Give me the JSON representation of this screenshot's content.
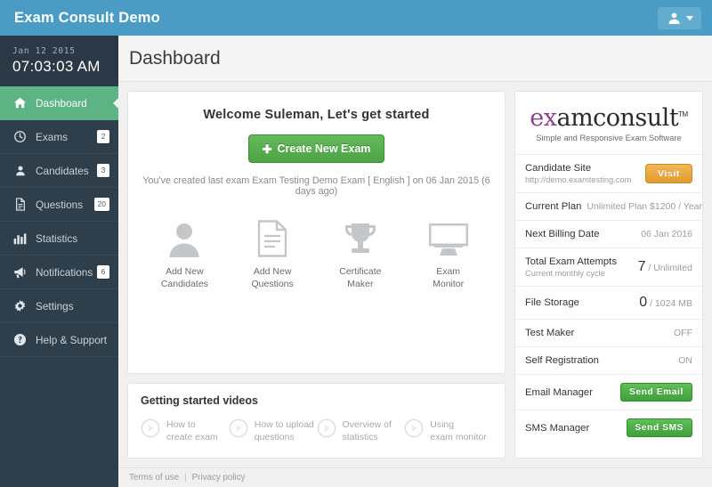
{
  "topbar": {
    "brand": "Exam Consult Demo",
    "user_icon": "user-avatar-icon",
    "caret_icon": "chevron-down-icon"
  },
  "sidebar": {
    "clock": {
      "date": "Jan 12 2015",
      "time": "07:03:03 AM"
    },
    "items": [
      {
        "label": "Dashboard",
        "icon": "home-icon",
        "badge": "",
        "active": true
      },
      {
        "label": "Exams",
        "icon": "clock-icon",
        "badge": "2",
        "active": false
      },
      {
        "label": "Candidates",
        "icon": "user-icon",
        "badge": "3",
        "active": false
      },
      {
        "label": "Questions",
        "icon": "document-icon",
        "badge": "20",
        "active": false
      },
      {
        "label": "Statistics",
        "icon": "bar-chart-icon",
        "badge": "",
        "active": false
      },
      {
        "label": "Notifications",
        "icon": "megaphone-icon",
        "badge": "6",
        "active": false
      },
      {
        "label": "Settings",
        "icon": "gear-icon",
        "badge": "",
        "active": false
      },
      {
        "label": "Help & Support",
        "icon": "question-mark-icon",
        "badge": "",
        "active": false
      }
    ]
  },
  "page": {
    "title": "Dashboard"
  },
  "welcome": {
    "title": "Welcome Suleman, Let's get started",
    "create_button": "Create New Exam",
    "plus_icon": "plus-icon",
    "last_exam": "You've created last exam Exam Testing Demo Exam [ English ] on 06 Jan 2015 (6 days ago)"
  },
  "quick_actions": [
    {
      "line1": "Add New",
      "line2": "Candidates",
      "icon": "person-icon"
    },
    {
      "line1": "Add New",
      "line2": "Questions",
      "icon": "page-lines-icon"
    },
    {
      "line1": "Certificate",
      "line2": "Maker",
      "icon": "trophy-icon"
    },
    {
      "line1": "Exam",
      "line2": "Monitor",
      "icon": "monitor-icon"
    }
  ],
  "videos": {
    "title": "Getting started videos",
    "items": [
      {
        "line1": "How to",
        "line2": "create exam",
        "icon": "play-circle-icon"
      },
      {
        "line1": "How to upload",
        "line2": "questions",
        "icon": "play-circle-icon"
      },
      {
        "line1": "Overview of",
        "line2": "statistics",
        "icon": "play-circle-icon"
      },
      {
        "line1": "Using",
        "line2": "exam monitor",
        "icon": "play-circle-icon"
      }
    ]
  },
  "account": {
    "logo": {
      "ex": "ex",
      "rest": "amconsult",
      "tm": "TM",
      "tagline": "Simple and Responsive Exam Software"
    },
    "rows": [
      {
        "label": "Candidate Site",
        "sub": "http://demo.examtesting.com",
        "value": "",
        "button": "Visit",
        "button_style": "orange"
      },
      {
        "label": "Current Plan",
        "sub": "",
        "value": "Unlimited Plan $1200 / Year",
        "button": "",
        "button_style": ""
      },
      {
        "label": "Next Billing Date",
        "sub": "",
        "value": "06 Jan 2016",
        "button": "",
        "button_style": ""
      },
      {
        "label": "Total Exam Attempts",
        "sub": "Current monthly cycle",
        "value_big": "7",
        "value": "/ Unlimited",
        "button": "",
        "button_style": ""
      },
      {
        "label": "File Storage",
        "sub": "",
        "value_big": "0",
        "value": "/ 1024 MB",
        "button": "",
        "button_style": ""
      },
      {
        "label": "Test Maker",
        "sub": "",
        "value": "OFF",
        "button": "",
        "button_style": ""
      },
      {
        "label": "Self Registration",
        "sub": "",
        "value": "ON",
        "button": "",
        "button_style": ""
      },
      {
        "label": "Email Manager",
        "sub": "",
        "value": "",
        "button": "Send Email",
        "button_style": "green"
      },
      {
        "label": "SMS Manager",
        "sub": "",
        "value": "",
        "button": "Send SMS",
        "button_style": "green"
      }
    ]
  },
  "footer": {
    "terms": "Terms of use",
    "separator": "|",
    "privacy": "Privacy policy"
  },
  "colors": {
    "header_blue": "#4a9cc4",
    "sidebar_dark": "#2e3e4a",
    "active_green": "#5cb485",
    "button_green": "#4da345",
    "button_orange": "#e09b2e",
    "logo_purple": "#8e3f8e"
  }
}
